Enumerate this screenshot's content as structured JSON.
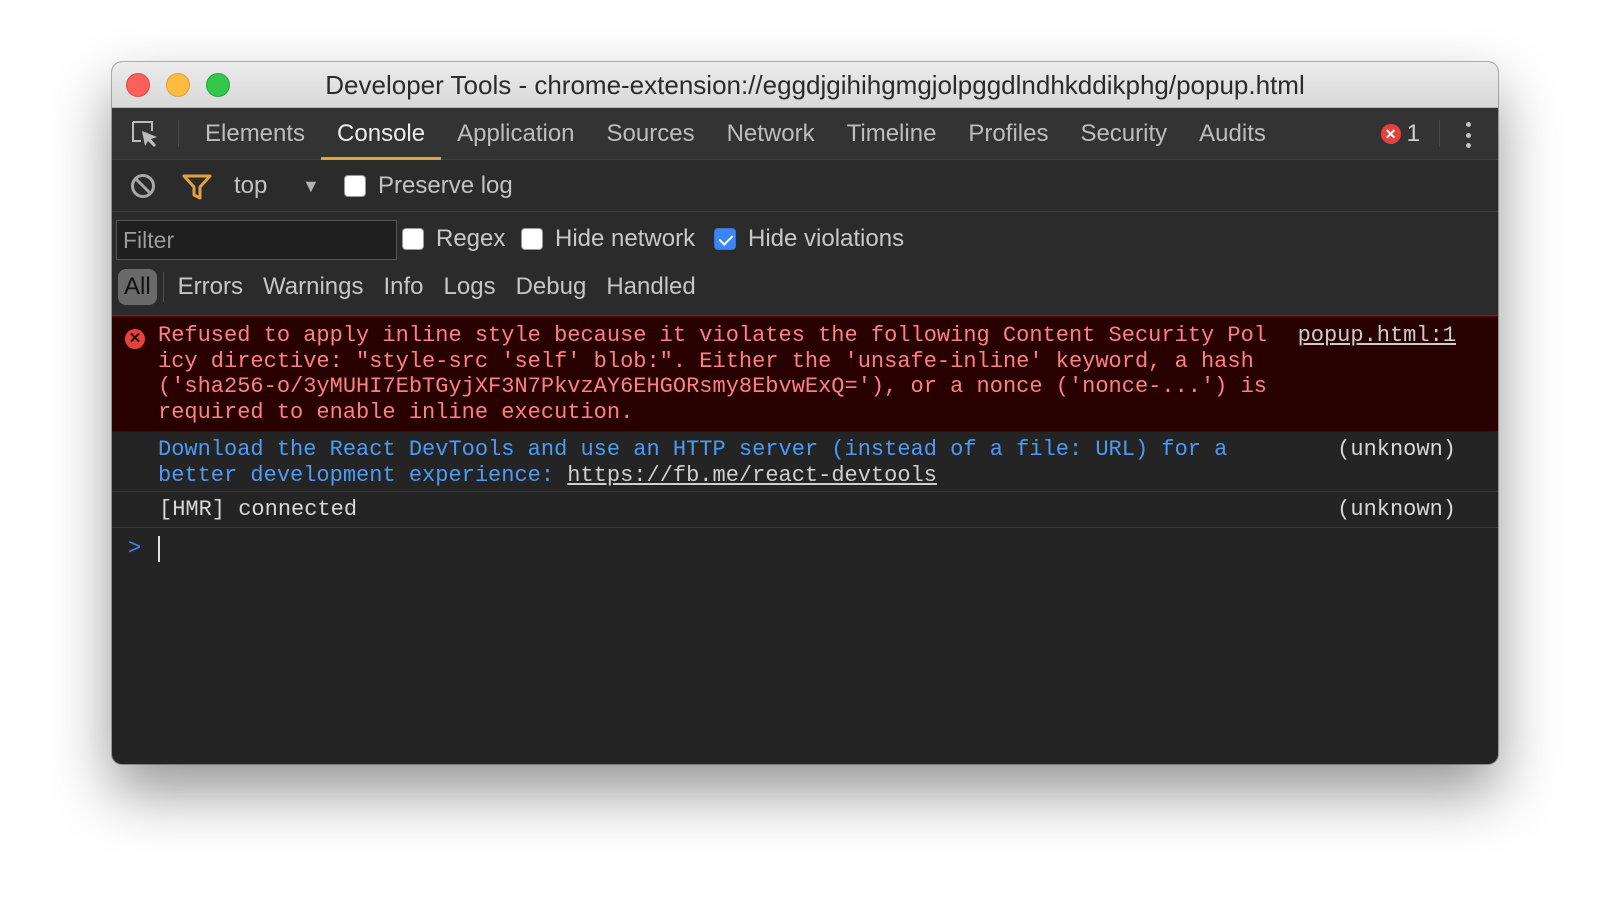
{
  "window": {
    "title": "Developer Tools - chrome-extension://eggdjgihihgmgjolpggdlndhkddikphg/popup.html"
  },
  "tabs": [
    {
      "label": "Elements",
      "active": false
    },
    {
      "label": "Console",
      "active": true
    },
    {
      "label": "Application",
      "active": false
    },
    {
      "label": "Sources",
      "active": false
    },
    {
      "label": "Network",
      "active": false
    },
    {
      "label": "Timeline",
      "active": false
    },
    {
      "label": "Profiles",
      "active": false
    },
    {
      "label": "Security",
      "active": false
    },
    {
      "label": "Audits",
      "active": false
    }
  ],
  "error_count": "1",
  "toolbar": {
    "context": "top",
    "preserve_log_label": "Preserve log",
    "preserve_log_checked": false
  },
  "filter": {
    "placeholder": "Filter",
    "value": "",
    "regex_label": "Regex",
    "regex_checked": false,
    "hide_network_label": "Hide network",
    "hide_network_checked": false,
    "hide_violations_label": "Hide violations",
    "hide_violations_checked": true
  },
  "levels": [
    "All",
    "Errors",
    "Warnings",
    "Info",
    "Logs",
    "Debug",
    "Handled"
  ],
  "messages": {
    "error": {
      "text": "Refused to apply inline style because it violates the following Content Security Policy directive: \"style-src 'self' blob:\". Either the 'unsafe-inline' keyword, a hash ('sha256-o/3yMUHI7EbTGyjXF3N7PkvzAY6EHGORsmy8EbvwExQ='), or a nonce ('nonce-...') is required to enable inline execution.",
      "source": "popup.html:1"
    },
    "info": {
      "text": "Download the React DevTools and use an HTTP server (instead of a file: URL) for a better development experience: ",
      "link": "https://fb.me/react-devtools",
      "source": "(unknown)"
    },
    "log": {
      "text": "[HMR] connected",
      "source": "(unknown)"
    }
  },
  "prompt_symbol": ">",
  "colors": {
    "accent_tab": "#e3a23c",
    "error_text": "#ff8080",
    "error_bg": "#290000",
    "info_text": "#4d9af5",
    "checkbox_checked": "#3a86f7"
  }
}
